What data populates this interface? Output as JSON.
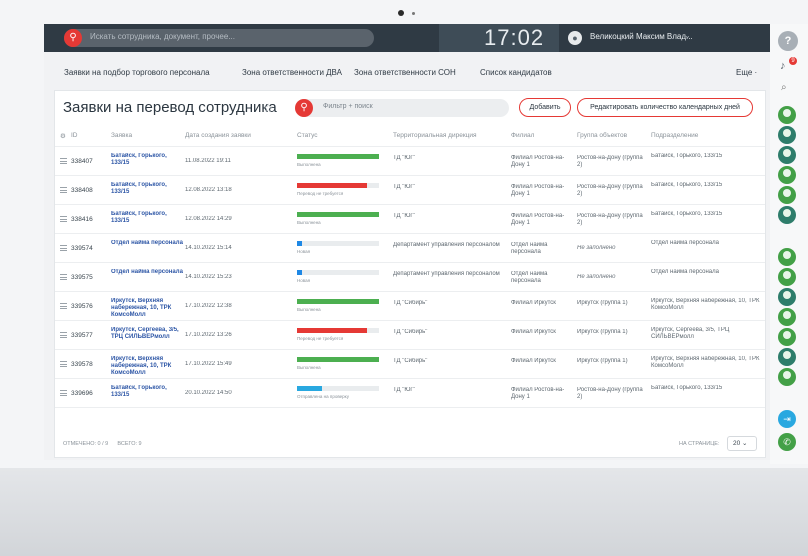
{
  "topbar": {
    "search_placeholder": "Искать сотрудника, документ, прочее...",
    "clock": "17:02",
    "user_name": "Великоцкий Максим Влад...",
    "user_chevron": "⌄"
  },
  "rail": {
    "help": "?",
    "bell_badge": "9",
    "search_glyph": "⌕",
    "exit_glyph": "⇥",
    "phone_glyph": "✆"
  },
  "tabs": [
    {
      "label": "Заявки на подбор торгового персонала"
    },
    {
      "label": "Зона ответственности ДВА"
    },
    {
      "label": "Зона ответственности СОН"
    },
    {
      "label": "Список кандидатов"
    }
  ],
  "tab_more": "Еще ·",
  "page": {
    "title": "Заявки на перевод сотрудника",
    "star": "☆",
    "filter_placeholder": "Фильтр + поиск",
    "add_button": "Добавить",
    "edit_button": "Редактировать количество календарных дней"
  },
  "columns": {
    "settings": "⚙",
    "id": "ID",
    "request": "Заявка",
    "created": "Дата создания заявки",
    "status": "Статус",
    "territory": "Территориальная дирекция",
    "branch": "Филиал",
    "group": "Группа объектов",
    "division": "Подразделение"
  },
  "rows": [
    {
      "id": "338407",
      "request": "Батайск, Горького, 133/15",
      "created": "11.08.2022 19:11",
      "status": "Выполнена",
      "progress": 1.0,
      "color": "#4caf50",
      "territory": "ТД \"Юг\"",
      "branch": "Филиал Ростов-на-Дону 1",
      "group": "Ростов-на-Дону (группа 2)",
      "division": "Батайск, Горького, 133/15"
    },
    {
      "id": "338408",
      "request": "Батайск, Горького, 133/15",
      "created": "12.08.2022 13:18",
      "status": "Перевод не требуется",
      "progress": 0.85,
      "color": "#e53935",
      "territory": "ТД \"Юг\"",
      "branch": "Филиал Ростов-на-Дону 1",
      "group": "Ростов-на-Дону (группа 2)",
      "division": "Батайск, Горького, 133/15"
    },
    {
      "id": "338416",
      "request": "Батайск, Горького, 133/15",
      "created": "12.08.2022 14:29",
      "status": "Выполнена",
      "progress": 1.0,
      "color": "#4caf50",
      "territory": "ТД \"Юг\"",
      "branch": "Филиал Ростов-на-Дону 1",
      "group": "Ростов-на-Дону (группа 2)",
      "division": "Батайск, Горького, 133/15"
    },
    {
      "id": "339574",
      "request": "Отдел найма персонала",
      "created": "14.10.2022 15:14",
      "status": "Новая",
      "progress": 0.06,
      "color": "#1e88e5",
      "territory": "Департамент управления персоналом",
      "branch": "Отдел найма персонала",
      "group": "Не заполнено",
      "division": "Отдел найма персонала"
    },
    {
      "id": "339575",
      "request": "Отдел найма персонала",
      "created": "14.10.2022 15:23",
      "status": "Новая",
      "progress": 0.06,
      "color": "#1e88e5",
      "territory": "Департамент управления персоналом",
      "branch": "Отдел найма персонала",
      "group": "Не заполнено",
      "division": "Отдел найма персонала"
    },
    {
      "id": "339576",
      "request": "Иркутск, Верхняя набережная, 10, ТРК КомсоМолл",
      "created": "17.10.2022 12:38",
      "status": "Выполнена",
      "progress": 1.0,
      "color": "#4caf50",
      "territory": "ТД \"Сибирь\"",
      "branch": "Филиал Иркутск",
      "group": "Иркутск (группа 1)",
      "division": "Иркутск, Верхняя набережная, 10, ТРК КомсоМолл"
    },
    {
      "id": "339577",
      "request": "Иркутск, Сергеева, 3/5, ТРЦ СИЛЬВЕРмолл",
      "created": "17.10.2022 13:26",
      "status": "Перевод не требуется",
      "progress": 0.85,
      "color": "#e53935",
      "territory": "ТД \"Сибирь\"",
      "branch": "Филиал Иркутск",
      "group": "Иркутск (группа 1)",
      "division": "Иркутск, Сергеева, 3/5, ТРЦ СИЛЬВЕРмолл"
    },
    {
      "id": "339578",
      "request": "Иркутск, Верхняя набережная, 10, ТРК КомсоМолл",
      "created": "17.10.2022 15:49",
      "status": "Выполнена",
      "progress": 1.0,
      "color": "#4caf50",
      "territory": "ТД \"Сибирь\"",
      "branch": "Филиал Иркутск",
      "group": "Иркутск (группа 1)",
      "division": "Иркутск, Верхняя набережная, 10, ТРК КомсоМолл"
    },
    {
      "id": "339696",
      "request": "Батайск, Горького, 133/15",
      "created": "20.10.2022 14:50",
      "status": "Отправлена на проверку",
      "progress": 0.3,
      "color": "#29a8e0",
      "territory": "ТД \"Юг\"",
      "branch": "Филиал Ростов-на-Дону 1",
      "group": "Ростов-на-Дону (группа 2)",
      "division": "Батайск, Горького, 133/15"
    }
  ],
  "footer": {
    "selected": "ОТМЕЧЕНО: 0 / 9",
    "total": "ВСЕГО: 9",
    "per_page_label": "НА СТРАНИЦЕ:",
    "per_page": "20 ⌄"
  },
  "colors": {
    "accent": "#e53935",
    "topbar": "#2f3a44",
    "link": "#2d56a6"
  }
}
